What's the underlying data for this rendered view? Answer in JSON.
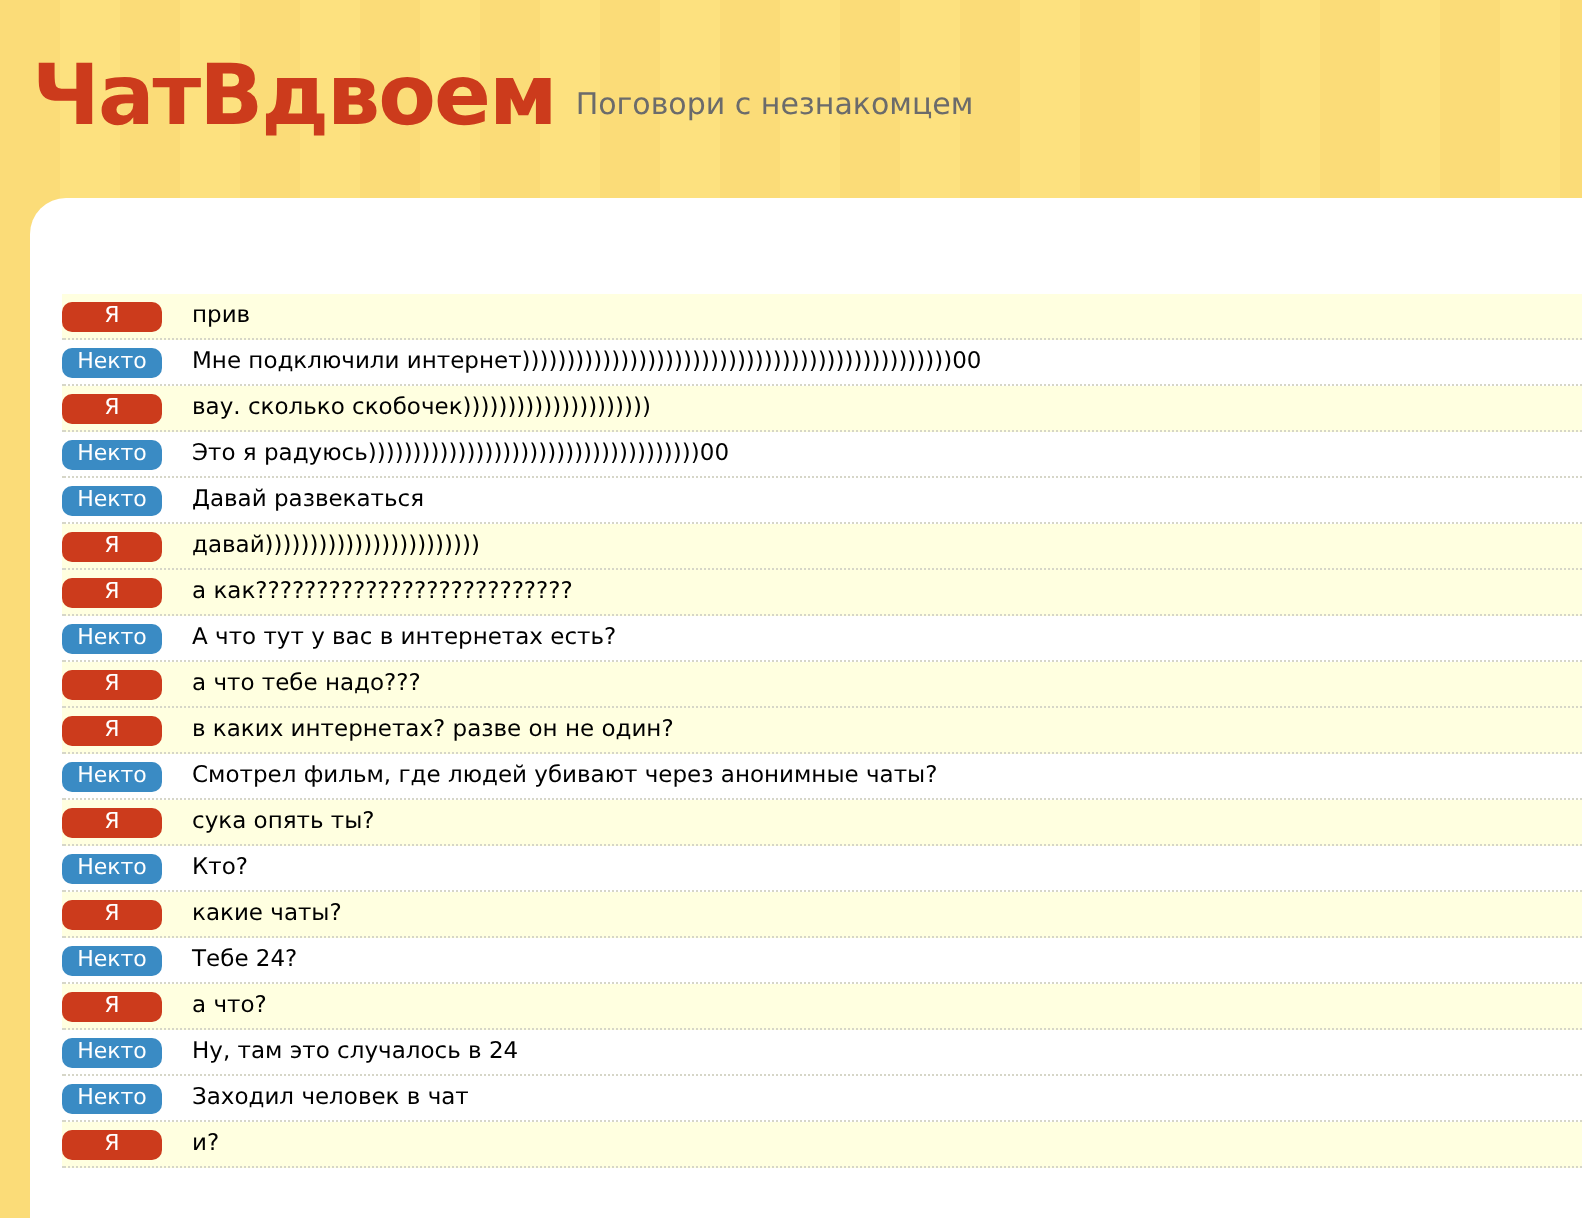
{
  "header": {
    "logo": "ЧатВдвоем",
    "tagline": "Поговори с незнакомцем"
  },
  "messages": [
    {
      "kind": "me",
      "sender": "Я",
      "text": "прив"
    },
    {
      "kind": "stranger",
      "sender": "Некто",
      "text": "Мне подключили интернет))))))))))))))))))))))))))))))))))))))))))))))))00"
    },
    {
      "kind": "me",
      "sender": "Я",
      "text": "вау. сколько скобочек)))))))))))))))))))))"
    },
    {
      "kind": "stranger",
      "sender": "Некто",
      "text": "Это я радуюсь)))))))))))))))))))))))))))))))))))))00"
    },
    {
      "kind": "stranger",
      "sender": "Некто",
      "text": "Давай развекаться"
    },
    {
      "kind": "me",
      "sender": "Я",
      "text": "давай))))))))))))))))))))))))"
    },
    {
      "kind": "me",
      "sender": "Я",
      "text": "а как??????????????????????????"
    },
    {
      "kind": "stranger",
      "sender": "Некто",
      "text": "А что тут у вас в интернетах есть?"
    },
    {
      "kind": "me",
      "sender": "Я",
      "text": "а что тебе надо???"
    },
    {
      "kind": "me",
      "sender": "Я",
      "text": "в каких интернетах? разве он не один?"
    },
    {
      "kind": "stranger",
      "sender": "Некто",
      "text": "Смотрел фильм, где людей убивают через анонимные чаты?"
    },
    {
      "kind": "me",
      "sender": "Я",
      "text": "сука опять ты?"
    },
    {
      "kind": "stranger",
      "sender": "Некто",
      "text": "Кто?"
    },
    {
      "kind": "me",
      "sender": "Я",
      "text": "какие чаты?"
    },
    {
      "kind": "stranger",
      "sender": "Некто",
      "text": "Тебе 24?"
    },
    {
      "kind": "me",
      "sender": "Я",
      "text": "а что?"
    },
    {
      "kind": "stranger",
      "sender": "Некто",
      "text": "Ну, там это случалось в 24"
    },
    {
      "kind": "stranger",
      "sender": "Некто",
      "text": "Заходил человек в чат"
    },
    {
      "kind": "me",
      "sender": "Я",
      "text": "и?"
    }
  ]
}
